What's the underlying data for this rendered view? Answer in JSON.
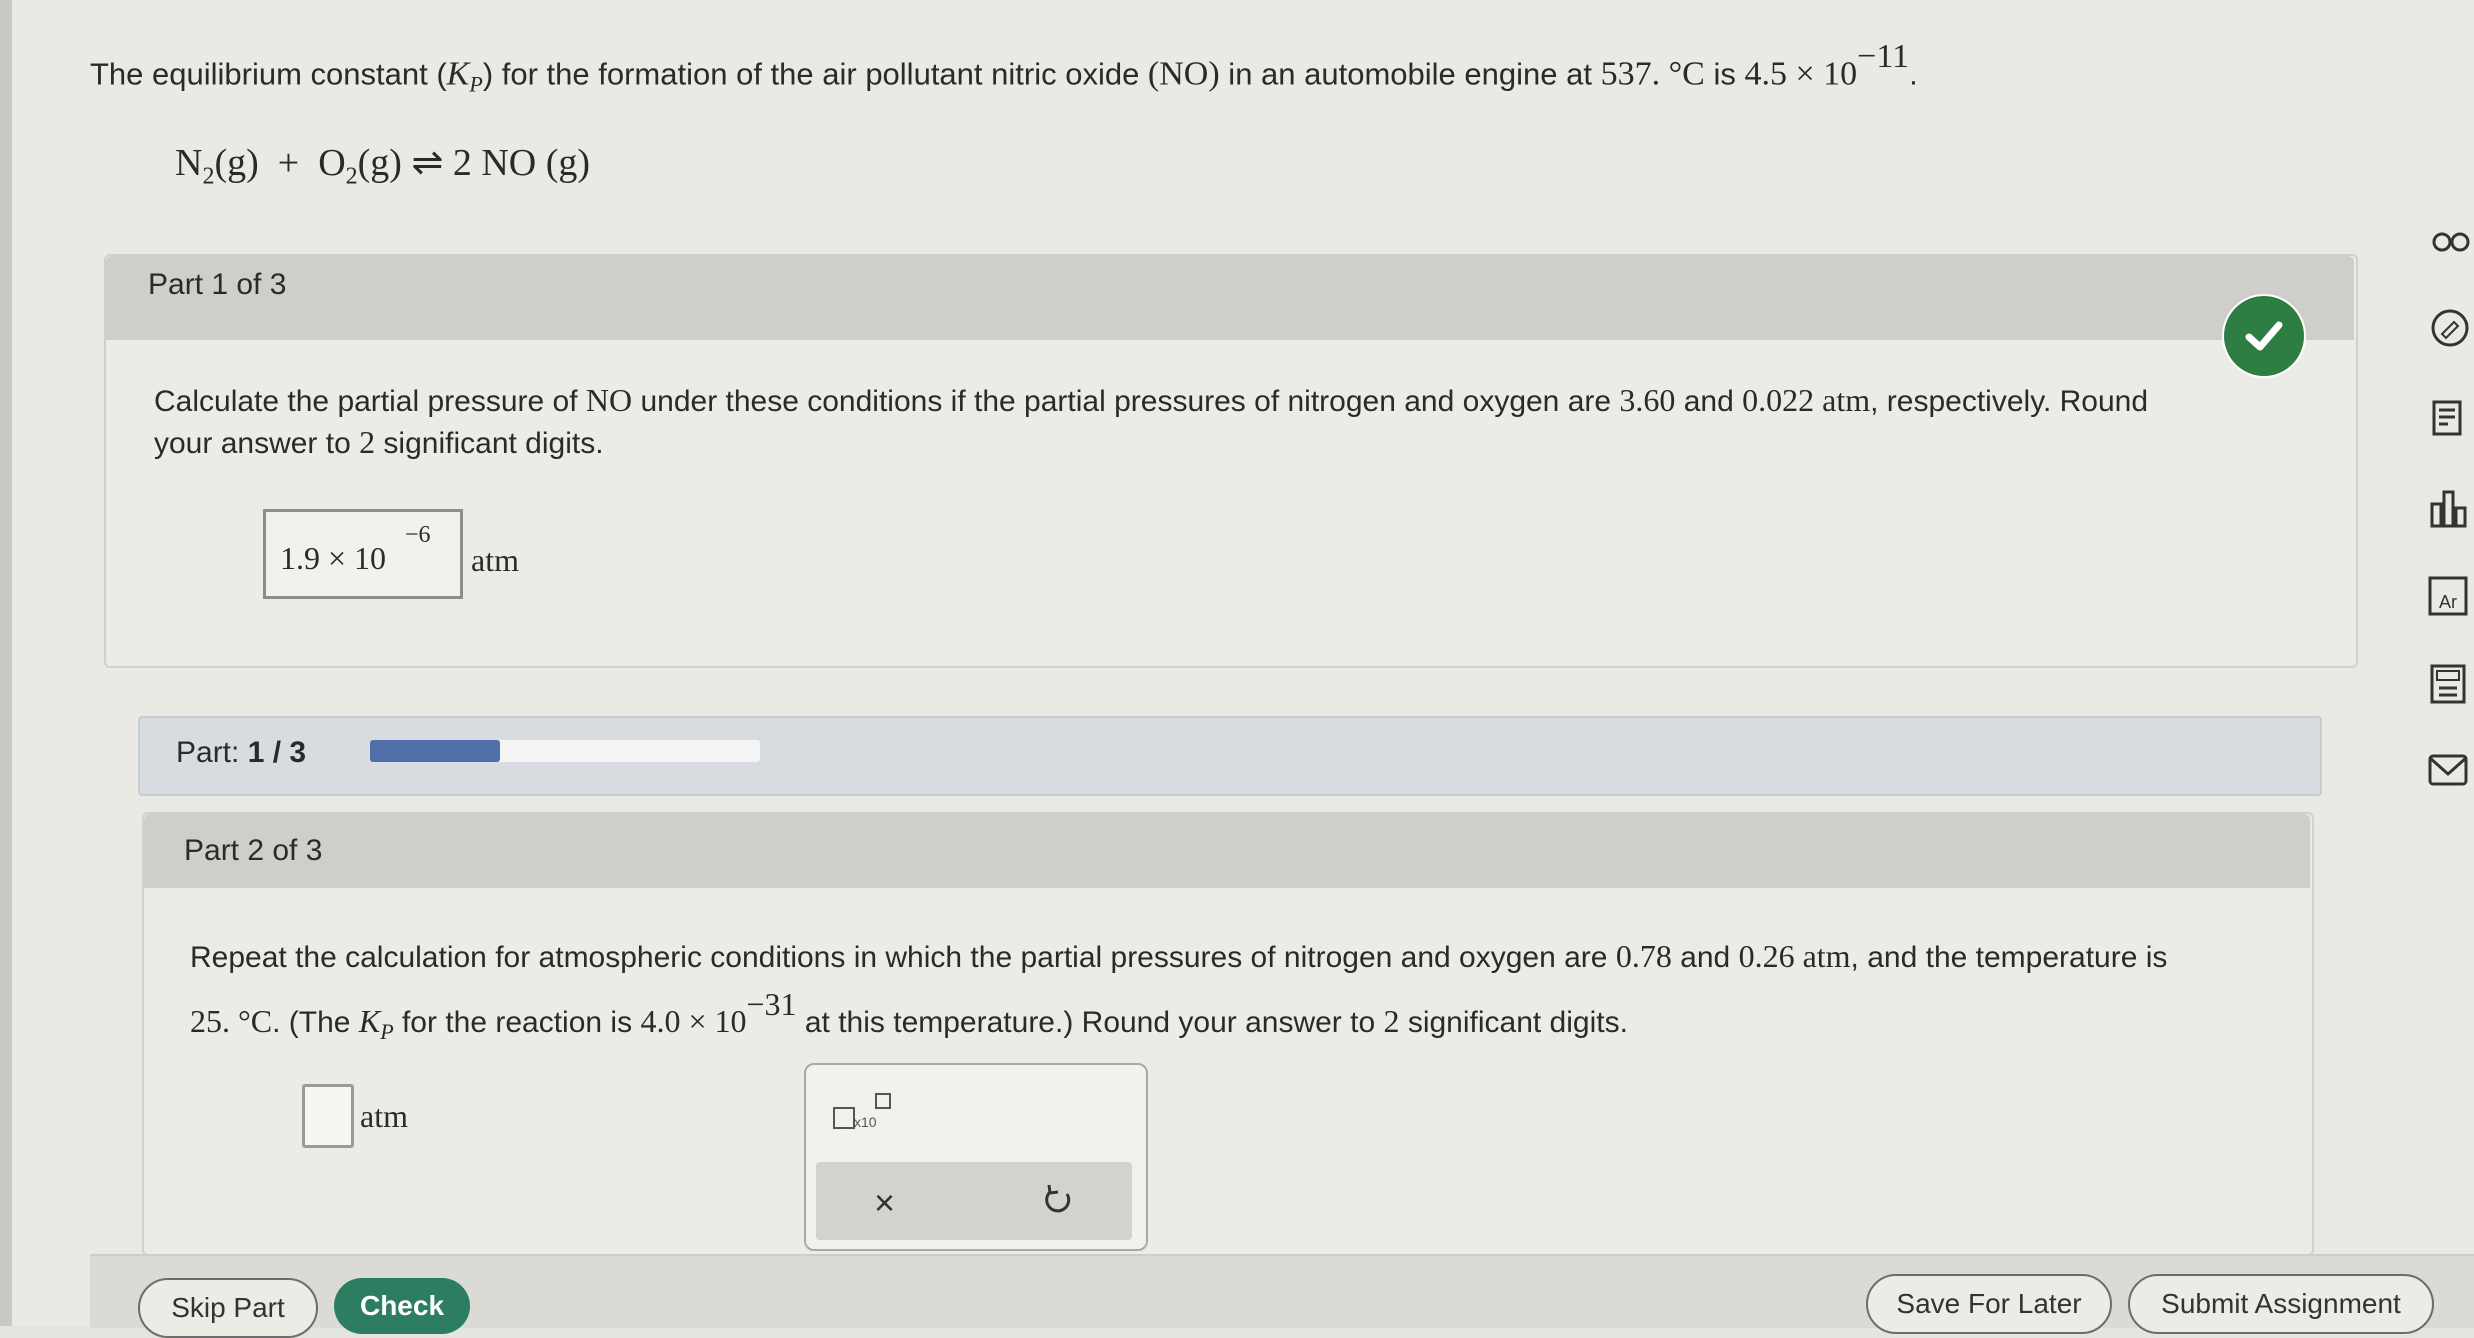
{
  "intro": {
    "text_a": "The equilibrium constant (",
    "kp": "K",
    "kp_sub": "P",
    "text_b": ") for the formation of the air pollutant nitric oxide ",
    "no": "(NO)",
    "text_c": " in an automobile engine at ",
    "temp": "537. °C",
    "text_d": " is ",
    "value": "4.5 × 10",
    "exp": "−11",
    "end": "."
  },
  "equation": {
    "n2": "N",
    "n2_sub": "2",
    "g1": "(g)",
    "plus": "+",
    "o2": "O",
    "o2_sub": "2",
    "g2": "(g)",
    "arrow": "⇌",
    "product": "2 NO (g)"
  },
  "part1": {
    "header": "Part 1 of 3",
    "q_a": "Calculate the partial pressure of ",
    "no": "NO",
    "q_b": " under these conditions if the partial pressures of nitrogen and oxygen are ",
    "p1": "3.60",
    "and": " and ",
    "p2": "0.022 atm",
    "q_c": ", respectively. Round",
    "q_line2": "your answer to ",
    "digits": "2",
    "q_end": " significant digits.",
    "answer_mantissa": "1.9 × 10",
    "answer_exp": "−6",
    "unit": "atm",
    "status": "correct"
  },
  "progress": {
    "label": "Part: ",
    "value": "1 / 3",
    "fraction": 0.333
  },
  "part2": {
    "header": "Part 2 of 3",
    "q_a": "Repeat the calculation for atmospheric conditions in which the partial pressures of nitrogen and oxygen are ",
    "p1": "0.78",
    "and": " and ",
    "p2": "0.26 atm",
    "q_b": ", and the temperature is",
    "temp": "25. °C",
    "q_c": ". (The ",
    "kp": "K",
    "kp_sub": "P",
    "q_d": " for the reaction is ",
    "value": "4.0 × 10",
    "exp": "−31",
    "q_e": " at this temperature.) Round your answer to ",
    "digits": "2",
    "q_f": " significant digits.",
    "unit": "atm",
    "x10_label": "x10",
    "clear_label": "×"
  },
  "buttons": {
    "skip": "Skip Part",
    "check": "Check",
    "save": "Save For Later",
    "submit": "Submit Assignment"
  },
  "colors": {
    "accent": "#2d7d62",
    "check_badge": "#2e7d43",
    "progress_fill": "#4f6fa8"
  },
  "sidebar_icons": [
    "link-icon",
    "pencil-icon",
    "notes-icon",
    "bar-chart-icon",
    "periodic-table-icon",
    "calculator-icon",
    "mail-icon"
  ]
}
